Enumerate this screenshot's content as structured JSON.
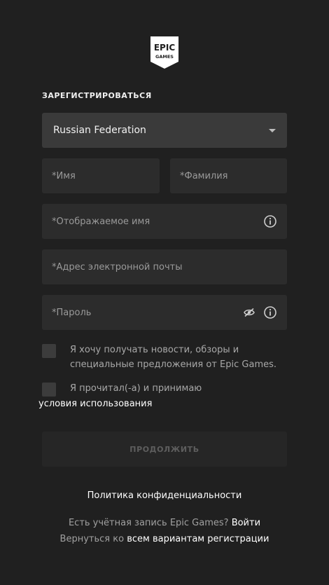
{
  "logo": {
    "line1": "EPIC",
    "line2": "GAMES"
  },
  "form": {
    "title": "ЗАРЕГИСТРИРОВАТЬСЯ",
    "country": {
      "value": "Russian Federation"
    },
    "first_name": {
      "placeholder": "*Имя"
    },
    "last_name": {
      "placeholder": "*Фамилия"
    },
    "display_name": {
      "placeholder": "*Отображаемое имя"
    },
    "email": {
      "placeholder": "*Адрес электронной почты"
    },
    "password": {
      "placeholder": "*Пароль"
    },
    "newsletter": {
      "label": "Я хочу получать новости, обзоры и специальные предложения от Epic Games.",
      "checked": false
    },
    "terms": {
      "label": "Я прочитал(-а) и принимаю",
      "link": "условия использования",
      "checked": false
    },
    "continue_label": "ПРОДОЛЖИТЬ"
  },
  "footer": {
    "privacy": "Политика конфиденциальности",
    "have_account": "Есть учётная запись Epic Games?",
    "login": "Войти",
    "back_prefix": "Вернуться ко",
    "all_options": "всем вариантам регистрации"
  },
  "icons": {
    "caret": "chevron-down-icon",
    "info": "info-icon",
    "hide_password": "eye-off-icon"
  },
  "colors": {
    "background": "#202020",
    "field": "#2c2c2c",
    "select": "#3a3a3a",
    "button_disabled_text": "#5e5e5e"
  }
}
